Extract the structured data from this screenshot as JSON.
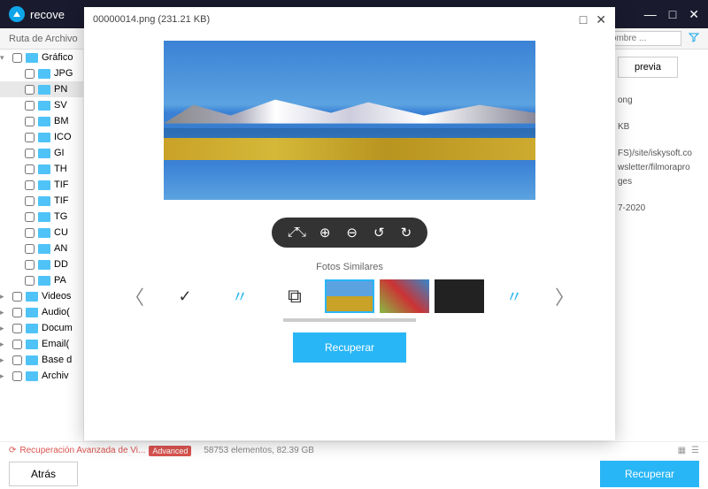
{
  "app": {
    "title": "recove",
    "window_controls": {
      "min": "—",
      "max": "□",
      "close": "✕"
    }
  },
  "toolbar": {
    "path_label": "Ruta de Archivo",
    "search_placeholder": "o nombre ...",
    "filter_icon": "⟘"
  },
  "sidebar": {
    "items": [
      {
        "label": "Gráfico",
        "type": "category",
        "expanded": true
      },
      {
        "label": "JPG",
        "type": "folder"
      },
      {
        "label": "PN",
        "type": "folder",
        "selected": true
      },
      {
        "label": "SV",
        "type": "folder"
      },
      {
        "label": "BM",
        "type": "folder"
      },
      {
        "label": "ICO",
        "type": "folder"
      },
      {
        "label": "GI",
        "type": "folder"
      },
      {
        "label": "TH",
        "type": "folder"
      },
      {
        "label": "TIF",
        "type": "folder"
      },
      {
        "label": "TIF",
        "type": "folder"
      },
      {
        "label": "TG",
        "type": "folder"
      },
      {
        "label": "CU",
        "type": "folder"
      },
      {
        "label": "AN",
        "type": "folder"
      },
      {
        "label": "DD",
        "type": "folder"
      },
      {
        "label": "PA",
        "type": "folder"
      },
      {
        "label": "Videos",
        "type": "category"
      },
      {
        "label": "Audio(",
        "type": "category"
      },
      {
        "label": "Docum",
        "type": "category"
      },
      {
        "label": "Email(",
        "type": "category"
      },
      {
        "label": "Base d",
        "type": "category"
      },
      {
        "label": "Archiv",
        "type": "category"
      }
    ]
  },
  "side_panel": {
    "preview_btn": "previa",
    "ext": "ong",
    "size": "KB",
    "path": "FS)/site/iskysoft.co wsletter/filmorapro ges",
    "date": "7-2020"
  },
  "status": {
    "adv_label": "Recuperación Avanzada de Vi...",
    "adv_badge": "Advanced",
    "count": "58753 elementos, 82.39 GB"
  },
  "footer": {
    "back": "Atrás",
    "recover": "Recuperar"
  },
  "modal": {
    "filename": "00000014.png (231.21 KB)",
    "controls": {
      "max": "□",
      "close": "✕"
    },
    "toolbar_icons": [
      "fit",
      "zoom-in",
      "zoom-out",
      "rotate-left",
      "rotate-right"
    ],
    "similar_label": "Fotos Similares",
    "thumbs": [
      {
        "type": "check"
      },
      {
        "type": "icon1"
      },
      {
        "type": "icon2"
      },
      {
        "type": "landscape",
        "active": true
      },
      {
        "type": "collage"
      },
      {
        "type": "dark"
      },
      {
        "type": "icon3"
      }
    ],
    "recover": "Recuperar"
  }
}
